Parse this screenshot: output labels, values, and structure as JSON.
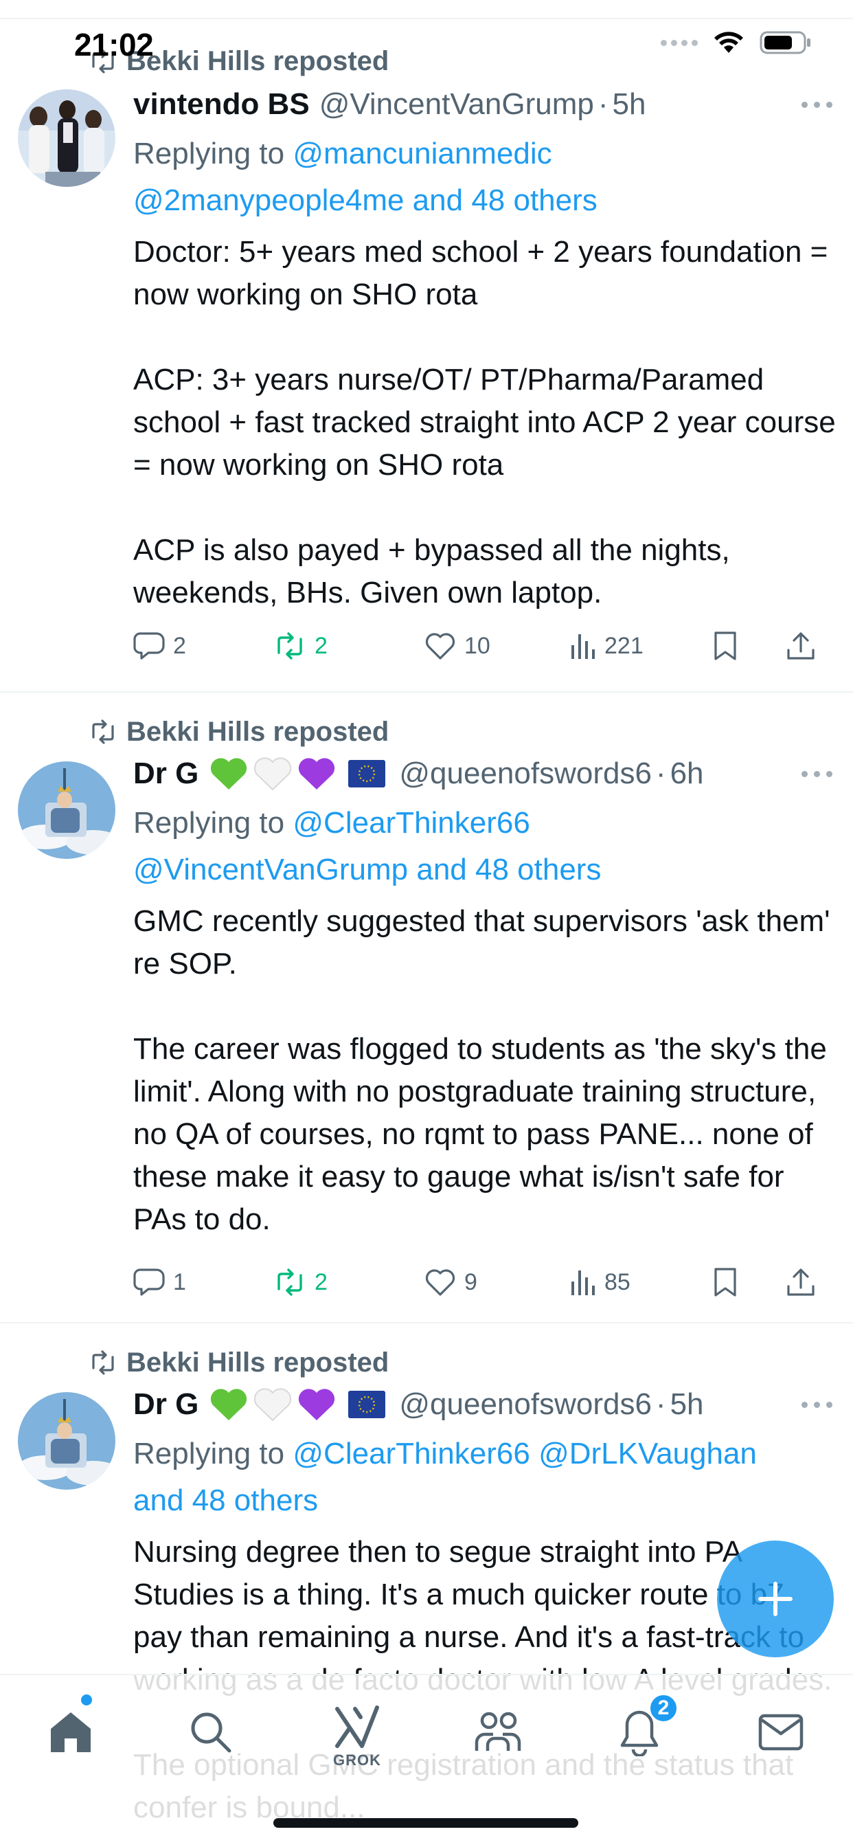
{
  "status_bar": {
    "time": "21:02"
  },
  "tweets": [
    {
      "reposted_by": "Bekki Hills reposted",
      "name": "vintendo BS",
      "handle": "@VincentVanGrump",
      "time": "5h",
      "replying_prefix": "Replying to",
      "replying_line1": "@mancunianmedic",
      "replying_line2": "@2manypeople4me and 48 others",
      "body": "Doctor: 5+ years med school + 2 years foundation = now working on SHO rota\n\nACP: 3+ years nurse/OT/ PT/Pharma/Paramed school + fast tracked straight into ACP 2 year course = now working on SHO rota\n\nACP is also payed + bypassed all the nights, weekends, BHs. Given own laptop.",
      "replies": "2",
      "reposts": "2",
      "likes": "10",
      "views": "221"
    },
    {
      "reposted_by": "Bekki Hills reposted",
      "name": "Dr G",
      "handle": "@queenofswords6",
      "time": "6h",
      "replying_prefix": "Replying to",
      "replying_line1": "@ClearThinker66",
      "replying_line2": "@VincentVanGrump and 48 others",
      "body": "GMC recently suggested that supervisors 'ask them' re SOP.\n\nThe career was flogged to students as 'the sky's the limit'.  Along with no postgraduate training structure, no QA of courses, no rqmt to pass PANE... none of these make it easy to gauge what is/isn't safe for PAs to do.",
      "replies": "1",
      "reposts": "2",
      "likes": "9",
      "views": "85"
    },
    {
      "reposted_by": "Bekki Hills reposted",
      "name": "Dr G",
      "handle": "@queenofswords6",
      "time": "5h",
      "replying_prefix": "Replying to",
      "replying_line1": "@ClearThinker66 @DrLKVaughan",
      "replying_line2": "and 48 others",
      "body": "Nursing degree then to segue straight into PA Studies is a thing. It's a much quicker route to b7 pay than remaining a nurse. And it's a fast-track to working as a de facto doctor with low A level grades.\n\nThe optional GMC registration and the status that confer is bound..."
    }
  ],
  "tabbar": {
    "grok_label": "GROK",
    "notification_count": "2"
  },
  "colors": {
    "accent": "#1d9bf0",
    "repost_green": "#00ba7c",
    "secondary_text": "#536471"
  }
}
